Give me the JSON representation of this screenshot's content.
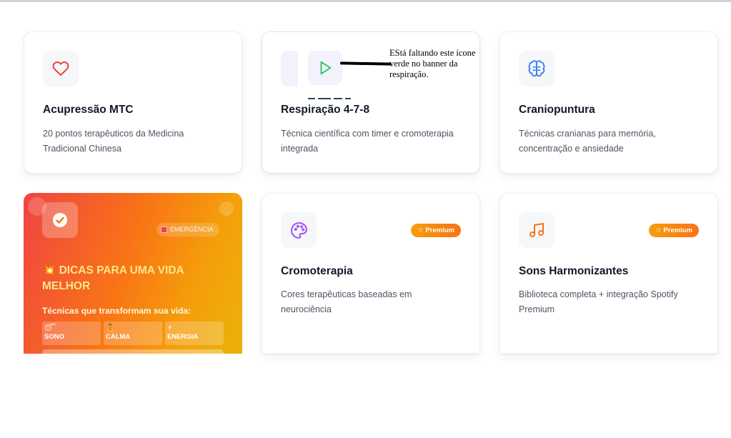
{
  "cards": {
    "acupressao": {
      "title": "Acupressão MTC",
      "desc": "20 pontos terapêuticos da Medicina Tradicional Chinesa",
      "icon": "heart-icon"
    },
    "respiracao": {
      "title": "Respiração 4-7-8",
      "desc": "Técnica científica com timer e cromoterapia integrada",
      "icon": "play-icon"
    },
    "craniopuntura": {
      "title": "Craniopuntura",
      "desc": "Técnicas cranianas para memória, concentração e ansiedade",
      "icon": "brain-icon"
    },
    "cromoterapia": {
      "title": "Cromoterapia",
      "desc": "Cores terapêuticas baseadas em neurociência",
      "badge": "☆ Premium",
      "icon": "palette-icon"
    },
    "sons": {
      "title": "Sons Harmonizantes",
      "desc": "Biblioteca completa + integração Spotify Premium",
      "badge": "☆ Premium",
      "icon": "music-icon"
    }
  },
  "dicas": {
    "badge": "EMERGÊNCIA",
    "title": "💥 DICAS PARA UMA VIDA MELHOR",
    "subtitle": "Técnicas que transformam sua vida:",
    "chips": [
      {
        "emoji": "😴",
        "label": "SONO"
      },
      {
        "emoji": "🧘",
        "label": "CALMA"
      },
      {
        "emoji": "⚡",
        "label": "ENERGIA"
      }
    ],
    "icon": "check-circle-icon"
  },
  "annotation": {
    "text": "EStá faltando este ícone verde no banner da respiração."
  },
  "colors": {
    "heart": "#ef4444",
    "play": "#22c55e",
    "brain": "#3b82f6",
    "palette": "#a855f7",
    "music": "#f97316",
    "premium": "#f59e0b"
  }
}
